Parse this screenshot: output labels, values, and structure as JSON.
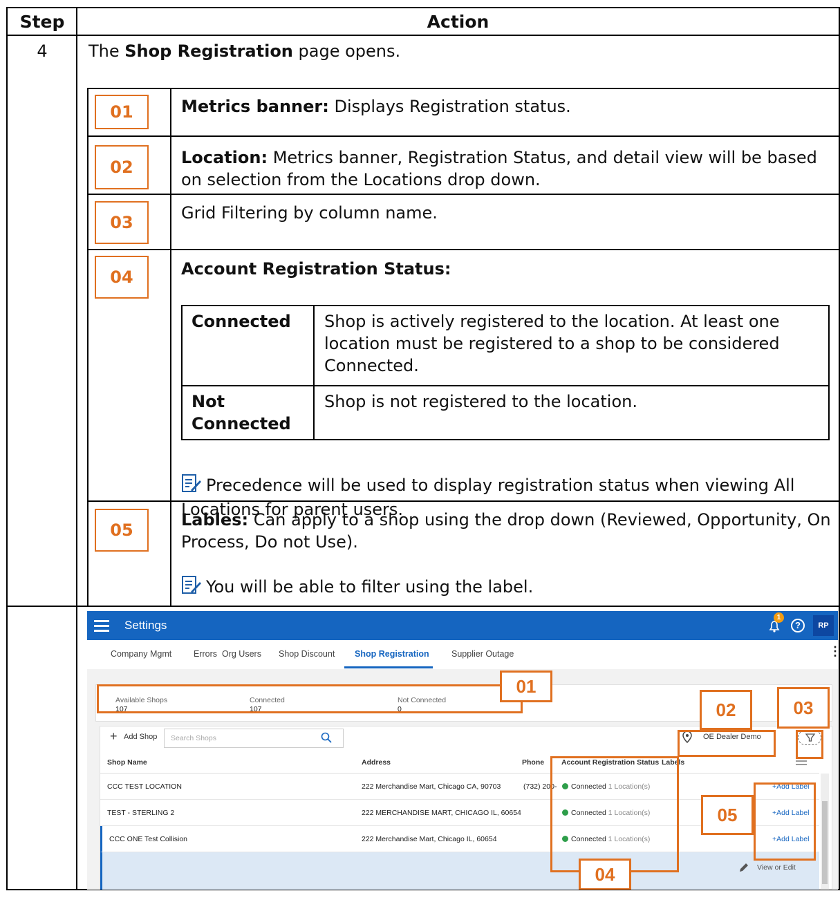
{
  "table": {
    "header_step": "Step",
    "header_action": "Action",
    "step_number": "4",
    "intro_prefix": "The ",
    "intro_bold": "Shop Registration",
    "intro_suffix": " page opens."
  },
  "callouts": [
    {
      "num": "01",
      "title": "Metrics banner:",
      "text": " Displays Registration status."
    },
    {
      "num": "02",
      "title": "Location:",
      "text": " Metrics banner, Registration Status, and detail view will be based on selection from the Locations drop down."
    },
    {
      "num": "03",
      "title": "",
      "text": "Grid Filtering by column name."
    },
    {
      "num": "04",
      "title": "Account Registration Status:",
      "text": ""
    },
    {
      "num": "05",
      "title": "Lables:",
      "text": " Can apply to a shop using the drop down (Reviewed, Opportunity, On Process, Do not Use)."
    }
  ],
  "status_table": [
    {
      "status": "Connected",
      "desc": "Shop is actively registered to the location. At least one location must be registered to a shop to be considered Connected."
    },
    {
      "status": "Not Connected",
      "desc": "Shop is not registered to the location."
    }
  ],
  "notes": {
    "precedence": "Precedence will be used to display registration status when viewing All Locations for parent users.",
    "labels": "You will be able to filter using the label."
  },
  "screenshot": {
    "app_title": "Settings",
    "notif_count": "1",
    "help_icon": "?",
    "avatar": "RP",
    "tabs": [
      "Company Mgmt",
      "Errors",
      "Org Users",
      "Shop Discount",
      "Shop Registration",
      "Supplier Outage"
    ],
    "active_tab": "Shop Registration",
    "metrics": [
      {
        "label": "Available Shops",
        "value": "107"
      },
      {
        "label": "Connected",
        "value": "107"
      },
      {
        "label": "Not Connected",
        "value": "0"
      }
    ],
    "add_shop": "Add Shop",
    "search_placeholder": "Search Shops",
    "location": "OE Dealer Demo",
    "columns": {
      "name": "Shop Name",
      "address": "Address",
      "phone": "Phone",
      "status": "Account Registration Status",
      "labels": "Labels"
    },
    "rows": [
      {
        "name": "CCC TEST LOCATION",
        "address": "222 Merchandise Mart, Chicago CA, 90703",
        "phone": "(732) 200-",
        "status": "Connected",
        "locations": "1 Location(s)",
        "label": "+Add Label"
      },
      {
        "name": "TEST - STERLING 2",
        "address": "222 MERCHANDISE MART, CHICAGO IL, 60654",
        "phone": "",
        "status": "Connected",
        "locations": "1 Location(s)",
        "label": "+Add Label"
      },
      {
        "name": "CCC ONE Test Collision",
        "address": "222 Merchandise Mart, Chicago IL, 60654",
        "phone": "",
        "status": "Connected",
        "locations": "1 Location(s)",
        "label": "+Add Label"
      }
    ],
    "view_edit": "View or Edit",
    "markers": [
      "01",
      "02",
      "03",
      "04",
      "05"
    ]
  },
  "colors": {
    "accent": "#e07020",
    "brand": "#1565c0",
    "connected": "#2e9e4a"
  }
}
